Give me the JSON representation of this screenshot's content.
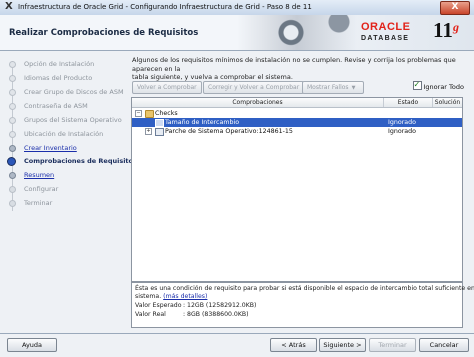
{
  "window": {
    "title": "Infraestructura de Oracle Grid - Configurando Infraestructura de Grid - Paso 8 de 11",
    "close_glyph": "X",
    "app_glyph": "X"
  },
  "header": {
    "page_title": "Realizar Comprobaciones de Requisitos",
    "brand_oracle": "ORACLE",
    "brand_database": "DATABASE",
    "brand_version": "11",
    "brand_version_suffix": "g",
    "brand_color": "#e2231a"
  },
  "steps": [
    {
      "label": "Opción de Instalación",
      "state": "done"
    },
    {
      "label": "Idiomas del Producto",
      "state": "done"
    },
    {
      "label": "Crear Grupo de Discos de ASM",
      "state": "done"
    },
    {
      "label": "Contraseña de ASM",
      "state": "done"
    },
    {
      "label": "Grupos del Sistema Operativo",
      "state": "done"
    },
    {
      "label": "Ubicación de Instalación",
      "state": "done"
    },
    {
      "label": "Crear Inventario",
      "state": "link"
    },
    {
      "label": "Comprobaciones de Requisitos",
      "state": "current"
    },
    {
      "label": "Resumen",
      "state": "link"
    },
    {
      "label": "Configurar",
      "state": "pending"
    },
    {
      "label": "Terminar",
      "state": "pending"
    }
  ],
  "intro": {
    "line1": "Algunos de los requisitos mínimos de instalación no se cumplen. Revise y corrija los problemas que aparecen en la",
    "line2": "tabla siguiente, y vuelva a comprobar el sistema."
  },
  "toolbar": {
    "check_again": "Volver a Comprobar",
    "fix_and_check": "Corregir y Volver a Comprobar",
    "show_failed": "Mostrar Fallos",
    "ignore_all": "Ignorar Todo",
    "ignore_all_checked": true
  },
  "table": {
    "columns": [
      "Comprobaciones",
      "Estado",
      "Solución"
    ],
    "rows": [
      {
        "label": "Checks",
        "status": "",
        "fixable": "",
        "level": 0,
        "selected": false
      },
      {
        "label": "Tamaño de Intercambio",
        "status": "Ignorado",
        "fixable": "",
        "level": 1,
        "selected": true
      },
      {
        "label": "Parche de Sistema Operativo:124861-15",
        "status": "Ignorado",
        "fixable": "",
        "level": 1,
        "selected": false
      }
    ]
  },
  "detail": {
    "text": "Ésta es una condición de requisito para probar si está disponible el espacio de intercambio total suficiente en el",
    "text2": "sistema.",
    "more_link": "(más detalles)",
    "expected_label": "Valor Esperado",
    "expected_value": ": 12GB (12582912.0KB)",
    "actual_label": "Valor Real",
    "actual_value": ": 8GB (8388600.0KB)"
  },
  "footer": {
    "help": "Ayuda",
    "back": "< Atrás",
    "next": "Siguiente >",
    "finish": "Terminar",
    "cancel": "Cancelar"
  }
}
